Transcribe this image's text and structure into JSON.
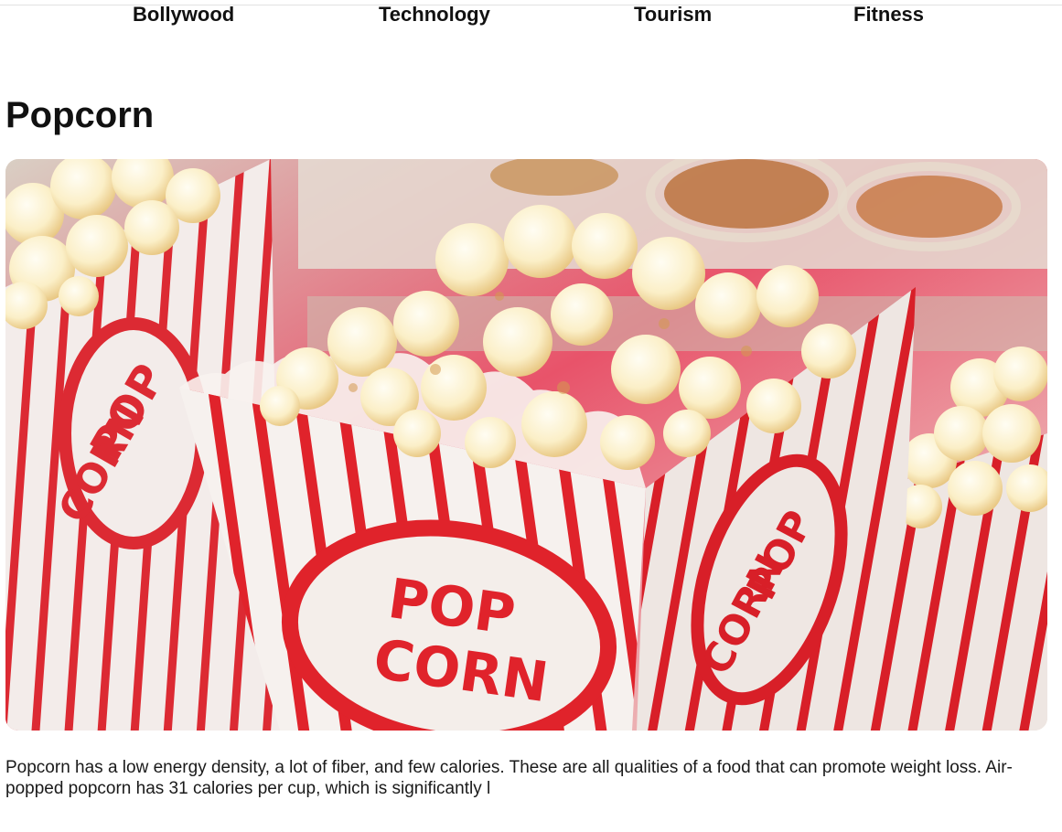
{
  "nav": {
    "items": [
      {
        "label": "Bollywood"
      },
      {
        "label": "Technology"
      },
      {
        "label": "Tourism"
      },
      {
        "label": "Fitness"
      }
    ]
  },
  "article": {
    "title": "Popcorn",
    "body": "Popcorn has a low energy density, a lot of fiber, and few calories. These are all qualities of a food that can promote weight loss. Air-popped popcorn has 31 calories per cup, which is significantly l",
    "image": {
      "carton_text_top": "POP",
      "carton_text_bottom": "CORN",
      "colors": {
        "stripe": "#e0232b",
        "carton": "#f6f1ee",
        "popcorn": "#fbefc9",
        "background": "#e2455c"
      }
    }
  }
}
